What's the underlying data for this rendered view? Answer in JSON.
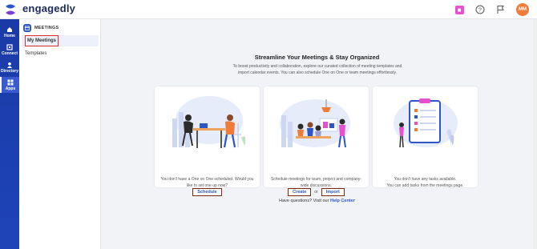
{
  "header": {
    "brand": "engagedly",
    "notification_badge": "■",
    "user_initials": "MM"
  },
  "rail": {
    "items": [
      {
        "label": "Home",
        "icon": "home-icon"
      },
      {
        "label": "Connect",
        "icon": "connect-icon"
      },
      {
        "label": "Directory",
        "icon": "directory-icon"
      },
      {
        "label": "Apps",
        "icon": "apps-icon",
        "active": true
      }
    ]
  },
  "sidebar": {
    "section_title": "MEETINGS",
    "items": [
      {
        "label": "My Meetings",
        "active": true
      },
      {
        "label": "Templates"
      }
    ]
  },
  "main": {
    "title": "Streamline Your Meetings & Stay Organized",
    "intro": "To boost productivity and collaboration, explore our curated collection of meeting templates and import calendar events. You can also schedule One on One or team meetings effortlessly.",
    "cards": [
      {
        "text": "You don't have a One on One scheduled. Would you like to set one up now?",
        "button": "Schedule"
      },
      {
        "text": "Schedule meetings for team, project and company-wide discussions.",
        "button_create": "Create",
        "connector": "or",
        "button_import": "Import"
      },
      {
        "text_line1": "You don't have any tasks available.",
        "text_line2": "You can add tasks from the meetings page."
      }
    ],
    "help_prefix": "Have questions? Visit our",
    "help_link": "Help Center"
  },
  "colors": {
    "primary": "#2b56c8",
    "rail": "#1a3aa7",
    "highlight_border": "#d92b2b",
    "button_border": "#7a2a12",
    "avatar": "#f07c3a",
    "notif": "#e84fd0"
  }
}
